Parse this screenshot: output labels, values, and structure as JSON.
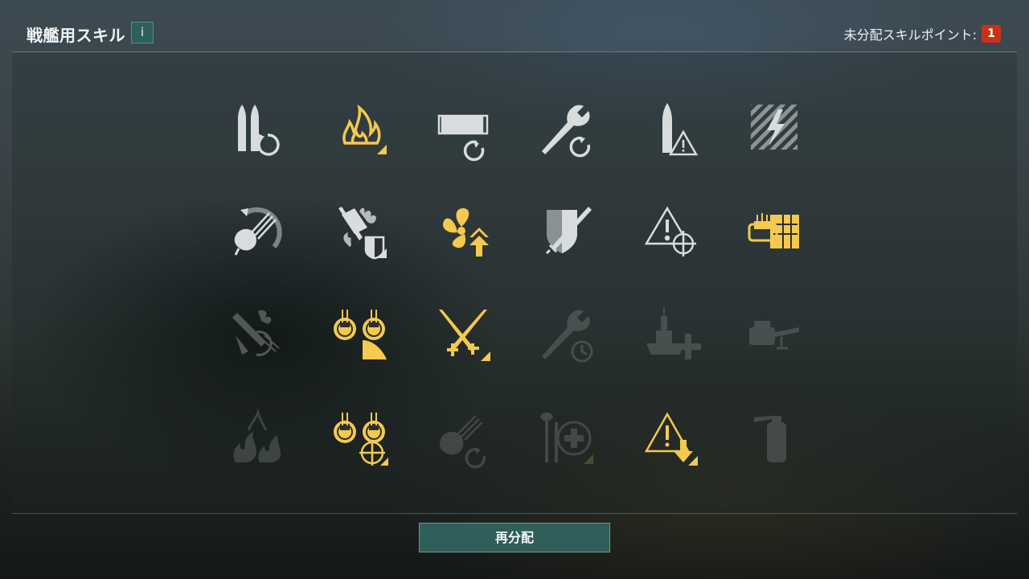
{
  "header": {
    "title": "戦艦用スキル",
    "info_label": "i"
  },
  "points": {
    "label": "未分配スキルポイント:",
    "value": "1"
  },
  "footer": {
    "redistribute_label": "再分配"
  },
  "colors": {
    "learned": "#f5c94e",
    "available": "#d8dcdc",
    "accent_button": "#2f5e5b",
    "badge": "#c8321a"
  },
  "skills": [
    [
      {
        "name": "reload-shells-icon",
        "state": "available"
      },
      {
        "name": "fire-icon",
        "state": "learned"
      },
      {
        "name": "torpedo-reload-icon",
        "state": "available"
      },
      {
        "name": "wrench-reload-icon",
        "state": "available"
      },
      {
        "name": "shell-warning-icon",
        "state": "available"
      },
      {
        "name": "lightning-hazard-icon",
        "state": "available"
      }
    ],
    [
      {
        "name": "turret-traverse-icon",
        "state": "available"
      },
      {
        "name": "fire-resistance-icon",
        "state": "available"
      },
      {
        "name": "propeller-boost-icon",
        "state": "learned"
      },
      {
        "name": "shield-sword-icon",
        "state": "available"
      },
      {
        "name": "warning-crosshair-icon",
        "state": "available"
      },
      {
        "name": "secondary-battery-icon",
        "state": "learned"
      }
    ],
    [
      {
        "name": "flooding-fire-icon",
        "state": "dim"
      },
      {
        "name": "aa-guns-range-icon",
        "state": "learned"
      },
      {
        "name": "crossed-swords-icon",
        "state": "learned"
      },
      {
        "name": "wrench-timer-icon",
        "state": "locked"
      },
      {
        "name": "ship-heal-icon",
        "state": "locked"
      },
      {
        "name": "secondary-gun-icon",
        "state": "locked"
      }
    ],
    [
      {
        "name": "fire-flood-icon",
        "state": "locked"
      },
      {
        "name": "aa-guns-crosshair-icon",
        "state": "learned"
      },
      {
        "name": "turret-reload-icon",
        "state": "locked"
      },
      {
        "name": "repair-heal-icon",
        "state": "locked"
      },
      {
        "name": "warning-down-icon",
        "state": "learned"
      },
      {
        "name": "fire-extinguisher-icon",
        "state": "locked"
      }
    ]
  ]
}
